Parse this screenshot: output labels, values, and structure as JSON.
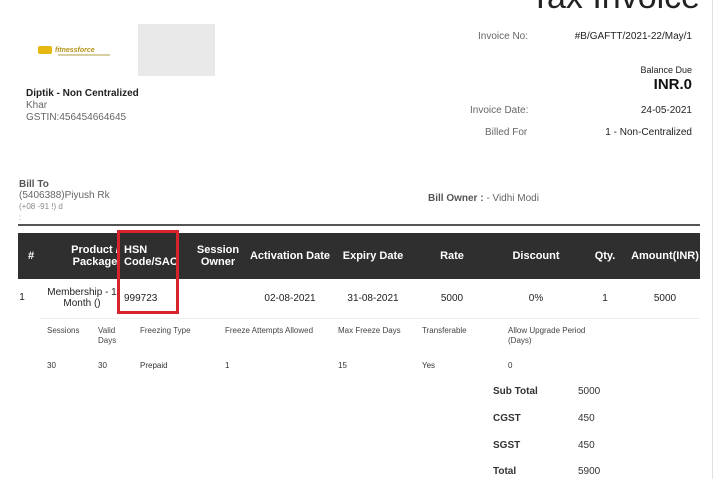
{
  "invoice": {
    "title": "Tax Invoice",
    "no_label": "Invoice No:",
    "no_value": "#B/GAFTT/2021-22/May/1",
    "balance_due_label": "Balance Due",
    "balance_due_value": "INR.0",
    "date_label": "Invoice Date:",
    "date_value": "24-05-2021",
    "billed_for_label": "Billed For",
    "billed_for_value": "1 - Non-Centralized"
  },
  "logo": {
    "text": "fitnessforce"
  },
  "company": {
    "name": "Diptik - Non Centralized",
    "location": "Khar",
    "gstin": "GSTIN:456454664645"
  },
  "bill_to": {
    "heading": "Bill To",
    "line1": "(5406388)Piyush Rk",
    "line2": "(+08          -91            !) d",
    "line3": ":"
  },
  "bill_owner": {
    "label": "Bill Owner :",
    "value": " - Vidhi Modi"
  },
  "table": {
    "headers": {
      "num": "#",
      "product_l1": "Product /",
      "product_l2": "Package",
      "hsn_l1": "HSN",
      "hsn_l2": "Code/SAC",
      "owner_l1": "Session",
      "owner_l2": "Owner",
      "activation": "Activation Date",
      "expiry": "Expiry Date",
      "rate": "Rate",
      "discount": "Discount",
      "qty": "Qty.",
      "amount": "Amount(INR)"
    },
    "row": {
      "num": "1",
      "product_l1": "Membership - 1",
      "product_l2": "Month ()",
      "hsn": "999723",
      "owner": "",
      "activation": "02-08-2021",
      "expiry": "31-08-2021",
      "rate": "5000",
      "discount": "0%",
      "qty": "1",
      "amount": "5000"
    },
    "details_headers": {
      "sessions": "Sessions",
      "valid_l1": "Valid",
      "valid_l2": "Days",
      "freezing_type": "Freezing Type",
      "freeze_attempts": "Freeze Attempts Allowed",
      "max_freeze": "Max Freeze Days",
      "transferable": "Transferable",
      "upgrade_l1": "Allow Upgrade Period",
      "upgrade_l2": "(Days)"
    },
    "details_values": {
      "sessions": "30",
      "valid": "30",
      "freezing_type": "Prepaid",
      "freeze_attempts": "1",
      "max_freeze": "15",
      "transferable": "Yes",
      "upgrade": "0"
    }
  },
  "totals": {
    "sub_total_label": "Sub Total",
    "sub_total_value": "5000",
    "cgst_label": "CGST",
    "cgst_value": "450",
    "sgst_label": "SGST",
    "sgst_value": "450",
    "total_label": "Total",
    "total_value": "5900"
  },
  "highlight_color": "#d8232a",
  "header_bg": "#2f2f2f"
}
